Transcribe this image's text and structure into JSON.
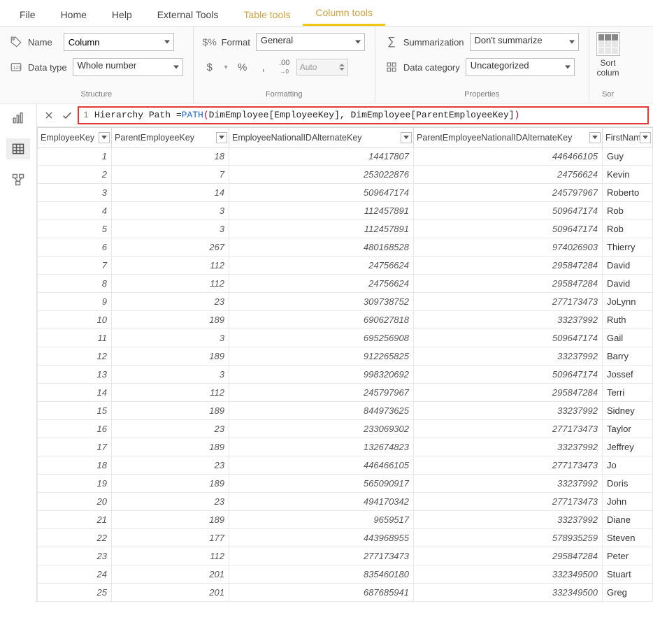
{
  "menu": {
    "tabs": [
      "File",
      "Home",
      "Help",
      "External Tools",
      "Table tools",
      "Column tools"
    ],
    "active": "Column tools",
    "highlight": [
      "Table tools",
      "Column tools"
    ]
  },
  "ribbon": {
    "structure": {
      "name_label": "Name",
      "name_value": "Column",
      "datatype_label": "Data type",
      "datatype_value": "Whole number",
      "group_label": "Structure"
    },
    "formatting": {
      "format_label": "Format",
      "format_value": "General",
      "auto_label": "Auto",
      "group_label": "Formatting"
    },
    "properties": {
      "sum_label": "Summarization",
      "sum_value": "Don't summarize",
      "cat_label": "Data category",
      "cat_value": "Uncategorized",
      "group_label": "Properties"
    },
    "sort": {
      "label_line1": "Sort",
      "label_line2": "colum",
      "group_label": "Sor"
    }
  },
  "formula": {
    "line_no": "1",
    "text_plain": "Hierarchy Path = PATH(DimEmployee[EmployeeKey], DimEmployee[ParentEmployeeKey])",
    "prefix": "Hierarchy Path = ",
    "func": "PATH",
    "args": "DimEmployee[EmployeeKey], DimEmployee[ParentEmployeeKey]"
  },
  "columns": [
    "EmployeeKey",
    "ParentEmployeeKey",
    "EmployeeNationalIDAlternateKey",
    "ParentEmployeeNationalIDAlternateKey",
    "FirstNam"
  ],
  "rows": [
    {
      "ek": "1",
      "pek": "18",
      "enid": "14417807",
      "penid": "446466105",
      "fn": "Guy"
    },
    {
      "ek": "2",
      "pek": "7",
      "enid": "253022876",
      "penid": "24756624",
      "fn": "Kevin"
    },
    {
      "ek": "3",
      "pek": "14",
      "enid": "509647174",
      "penid": "245797967",
      "fn": "Roberto"
    },
    {
      "ek": "4",
      "pek": "3",
      "enid": "112457891",
      "penid": "509647174",
      "fn": "Rob"
    },
    {
      "ek": "5",
      "pek": "3",
      "enid": "112457891",
      "penid": "509647174",
      "fn": "Rob"
    },
    {
      "ek": "6",
      "pek": "267",
      "enid": "480168528",
      "penid": "974026903",
      "fn": "Thierry"
    },
    {
      "ek": "7",
      "pek": "112",
      "enid": "24756624",
      "penid": "295847284",
      "fn": "David"
    },
    {
      "ek": "8",
      "pek": "112",
      "enid": "24756624",
      "penid": "295847284",
      "fn": "David"
    },
    {
      "ek": "9",
      "pek": "23",
      "enid": "309738752",
      "penid": "277173473",
      "fn": "JoLynn"
    },
    {
      "ek": "10",
      "pek": "189",
      "enid": "690627818",
      "penid": "33237992",
      "fn": "Ruth"
    },
    {
      "ek": "11",
      "pek": "3",
      "enid": "695256908",
      "penid": "509647174",
      "fn": "Gail"
    },
    {
      "ek": "12",
      "pek": "189",
      "enid": "912265825",
      "penid": "33237992",
      "fn": "Barry"
    },
    {
      "ek": "13",
      "pek": "3",
      "enid": "998320692",
      "penid": "509647174",
      "fn": "Jossef"
    },
    {
      "ek": "14",
      "pek": "112",
      "enid": "245797967",
      "penid": "295847284",
      "fn": "Terri"
    },
    {
      "ek": "15",
      "pek": "189",
      "enid": "844973625",
      "penid": "33237992",
      "fn": "Sidney"
    },
    {
      "ek": "16",
      "pek": "23",
      "enid": "233069302",
      "penid": "277173473",
      "fn": "Taylor"
    },
    {
      "ek": "17",
      "pek": "189",
      "enid": "132674823",
      "penid": "33237992",
      "fn": "Jeffrey"
    },
    {
      "ek": "18",
      "pek": "23",
      "enid": "446466105",
      "penid": "277173473",
      "fn": "Jo"
    },
    {
      "ek": "19",
      "pek": "189",
      "enid": "565090917",
      "penid": "33237992",
      "fn": "Doris"
    },
    {
      "ek": "20",
      "pek": "23",
      "enid": "494170342",
      "penid": "277173473",
      "fn": "John"
    },
    {
      "ek": "21",
      "pek": "189",
      "enid": "9659517",
      "penid": "33237992",
      "fn": "Diane"
    },
    {
      "ek": "22",
      "pek": "177",
      "enid": "443968955",
      "penid": "578935259",
      "fn": "Steven"
    },
    {
      "ek": "23",
      "pek": "112",
      "enid": "277173473",
      "penid": "295847284",
      "fn": "Peter"
    },
    {
      "ek": "24",
      "pek": "201",
      "enid": "835460180",
      "penid": "332349500",
      "fn": "Stuart"
    },
    {
      "ek": "25",
      "pek": "201",
      "enid": "687685941",
      "penid": "332349500",
      "fn": "Greg"
    }
  ]
}
